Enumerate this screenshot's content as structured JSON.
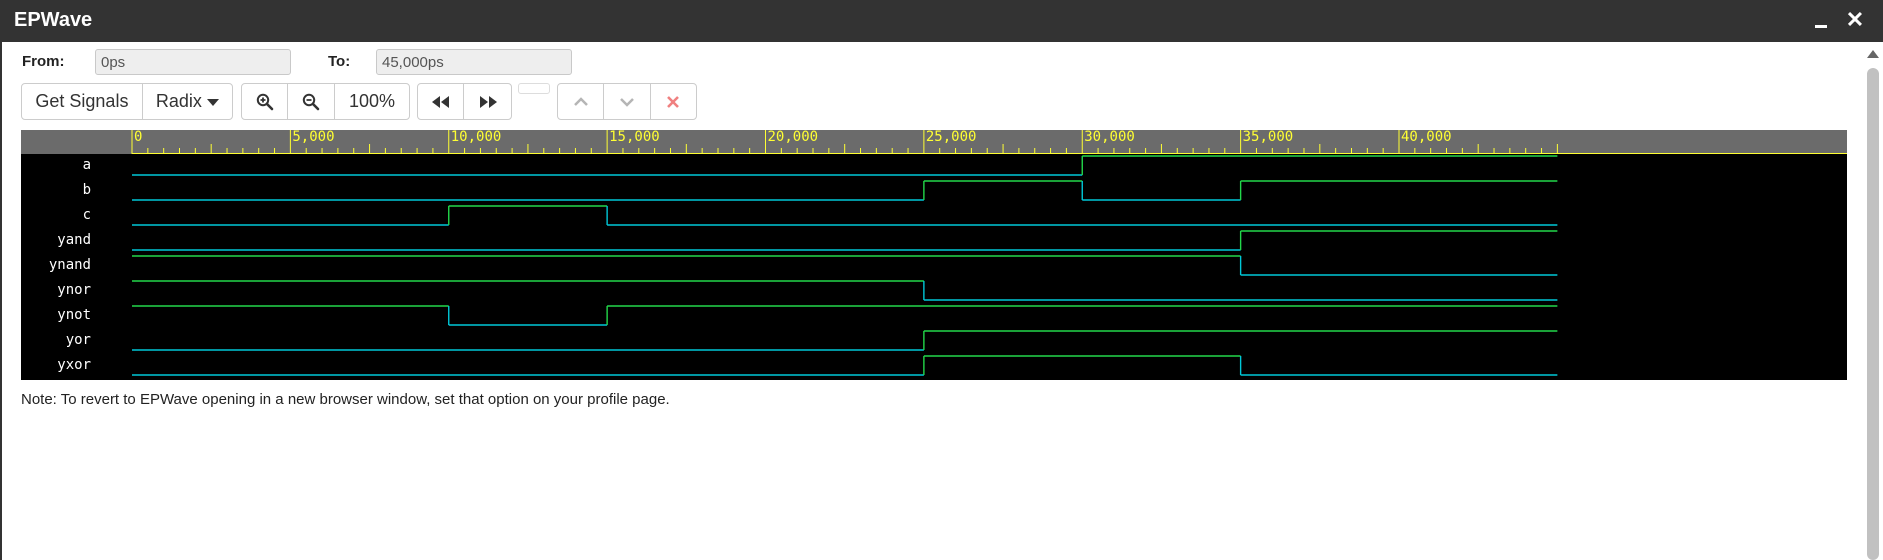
{
  "window": {
    "title": "EPWave",
    "minimize_label": "_",
    "close_label": "✕"
  },
  "range": {
    "from_label": "From:",
    "from_value": "0ps",
    "to_label": "To:",
    "to_value": "45,000ps"
  },
  "toolbar": {
    "get_signals": "Get Signals",
    "radix": "Radix",
    "zoom_in_icon": "zoom-in-icon",
    "zoom_out_icon": "zoom-out-icon",
    "zoom_level": "100%",
    "prev_edge_icon": "fast-backward-icon",
    "next_edge_icon": "fast-forward-icon",
    "move_up_icon": "chevron-up-icon",
    "move_down_icon": "chevron-down-icon",
    "delete_icon": "close-icon"
  },
  "timeline": {
    "tick_labels": [
      "0",
      "5,000",
      "10,000",
      "15,000",
      "20,000",
      "25,000",
      "30,000",
      "35,000",
      "40,000"
    ],
    "label_values": [
      0,
      5000,
      10000,
      15000,
      20000,
      25000,
      30000,
      35000,
      40000
    ],
    "range": [
      0,
      45000
    ],
    "minor_step": 500,
    "tick_color": "#ffff33"
  },
  "signals": [
    {
      "name": "a",
      "initial": 0,
      "transitions": [
        30000
      ]
    },
    {
      "name": "b",
      "initial": 0,
      "transitions": [
        25000,
        30000,
        35000
      ]
    },
    {
      "name": "c",
      "initial": 0,
      "transitions": [
        10000,
        15000
      ]
    },
    {
      "name": "yand",
      "initial": 0,
      "transitions": [
        35000
      ]
    },
    {
      "name": "ynand",
      "initial": 1,
      "transitions": [
        35000
      ]
    },
    {
      "name": "ynor",
      "initial": 1,
      "transitions": [
        25000
      ]
    },
    {
      "name": "ynot",
      "initial": 1,
      "transitions": [
        10000,
        15000
      ]
    },
    {
      "name": "yor",
      "initial": 0,
      "transitions": [
        25000
      ]
    },
    {
      "name": "yxor",
      "initial": 0,
      "transitions": [
        25000,
        35000
      ]
    }
  ],
  "colors": {
    "low": "#00c8d8",
    "high": "#22d84a",
    "background": "#000000",
    "ruler": "#6b6b6b"
  },
  "note": "Note: To revert to EPWave opening in a new browser window, set that option on your profile page."
}
